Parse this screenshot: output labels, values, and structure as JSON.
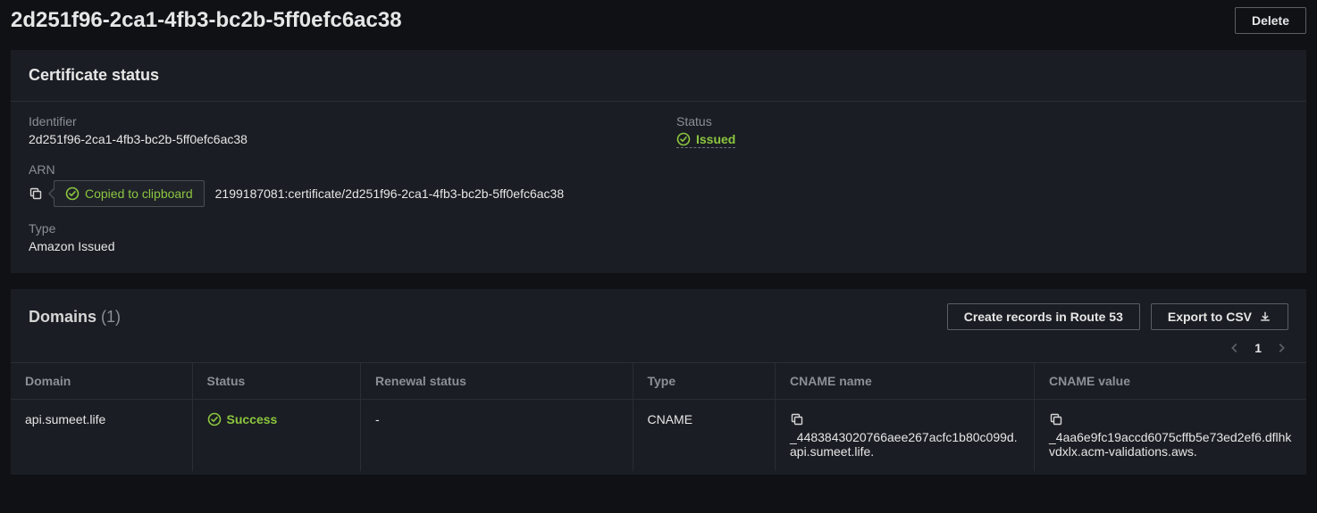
{
  "header": {
    "title": "2d251f96-2ca1-4fb3-bc2b-5ff0efc6ac38",
    "delete_label": "Delete"
  },
  "cert_status": {
    "panel_title": "Certificate status",
    "labels": {
      "identifier": "Identifier",
      "status": "Status",
      "arn": "ARN",
      "type": "Type"
    },
    "values": {
      "identifier": "2d251f96-2ca1-4fb3-bc2b-5ff0efc6ac38",
      "status": "Issued",
      "arn_suffix": "2199187081:certificate/2d251f96-2ca1-4fb3-bc2b-5ff0efc6ac38",
      "type": "Amazon Issued"
    },
    "tooltip_text": "Copied to clipboard"
  },
  "domains": {
    "panel_title": "Domains",
    "count_display": "(1)",
    "create_records_label": "Create records in Route 53",
    "export_label": "Export to CSV",
    "page_current": "1",
    "columns": {
      "domain": "Domain",
      "status": "Status",
      "renewal": "Renewal status",
      "type": "Type",
      "cname_name": "CNAME name",
      "cname_value": "CNAME value"
    },
    "rows": [
      {
        "domain": "api.sumeet.life",
        "status": "Success",
        "renewal": "-",
        "type": "CNAME",
        "cname_name": "_4483843020766aee267acfc1b80c099d.api.sumeet.life.",
        "cname_value": "_4aa6e9fc19accd6075cffb5e73ed2ef6.dflhkvdxlx.acm-validations.aws."
      }
    ]
  }
}
